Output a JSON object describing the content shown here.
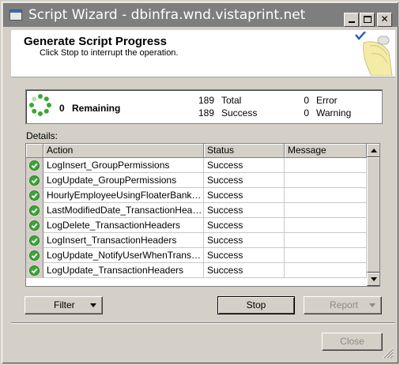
{
  "window": {
    "title": "Script Wizard - dbinfra.wnd.vistaprint.net",
    "controls": [
      "minimize-icon",
      "maximize-icon",
      "close-icon"
    ]
  },
  "header": {
    "title": "Generate Script Progress",
    "subtitle": "Click Stop to interrupt the operation."
  },
  "summary": {
    "remaining_count": "0",
    "remaining_label": "Remaining",
    "total_count": "189",
    "total_label": "Total",
    "success_count": "189",
    "success_label": "Success",
    "error_count": "0",
    "error_label": "Error",
    "warning_count": "0",
    "warning_label": "Warning"
  },
  "details": {
    "label": "Details:",
    "columns": {
      "action": "Action",
      "status": "Status",
      "message": "Message"
    },
    "rows": [
      {
        "action": "LogInsert_GroupPermissions",
        "status": "Success",
        "message": ""
      },
      {
        "action": "LogUpdate_GroupPermissions",
        "status": "Success",
        "message": ""
      },
      {
        "action": "HourlyEmployeeUsingFloaterBankIsFl...",
        "status": "Success",
        "message": ""
      },
      {
        "action": "LastModifiedDate_TransactionHeaders",
        "status": "Success",
        "message": ""
      },
      {
        "action": "LogDelete_TransactionHeaders",
        "status": "Success",
        "message": ""
      },
      {
        "action": "LogInsert_TransactionHeaders",
        "status": "Success",
        "message": ""
      },
      {
        "action": "LogUpdate_NotifyUserWhenTransact...",
        "status": "Success",
        "message": ""
      },
      {
        "action": "LogUpdate_TransactionHeaders",
        "status": "Success",
        "message": ""
      }
    ]
  },
  "buttons": {
    "filter": "Filter",
    "stop": "Stop",
    "report": "Report",
    "close": "Close"
  },
  "colors": {
    "success_green": "#3aa635",
    "titlebar": "#7e7e7e",
    "face": "#d4d0c8"
  }
}
